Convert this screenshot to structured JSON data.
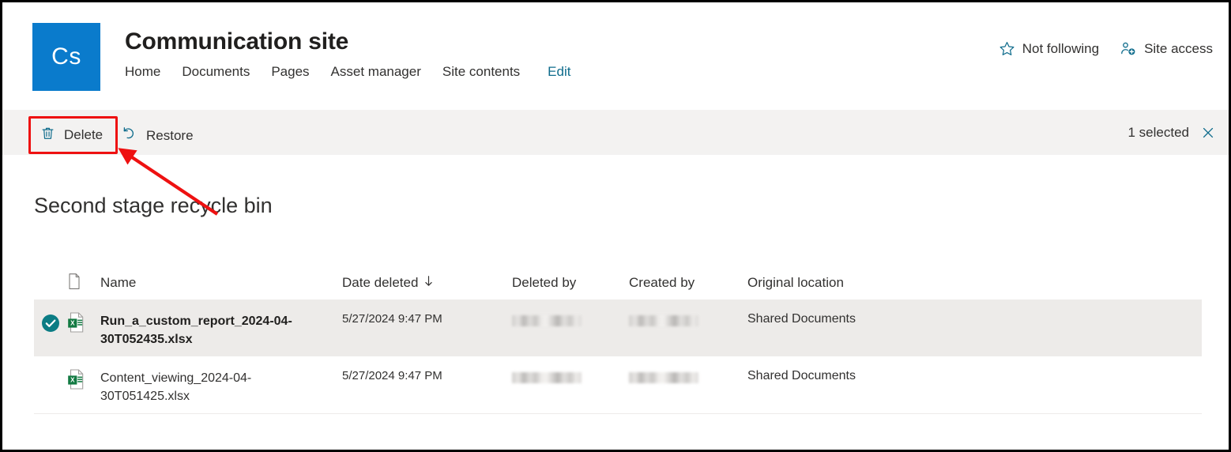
{
  "site": {
    "logo_text": "Cs",
    "logo_color": "#0A7BCC",
    "title": "Communication site",
    "nav": [
      {
        "label": "Home"
      },
      {
        "label": "Documents"
      },
      {
        "label": "Pages"
      },
      {
        "label": "Asset manager"
      },
      {
        "label": "Site contents"
      }
    ],
    "edit_link": "Edit",
    "edit_link_color": "#0f6c8c",
    "actions": [
      {
        "label": "Not following",
        "icon": "star-outline-icon"
      },
      {
        "label": "Site access",
        "icon": "people-add-icon"
      }
    ]
  },
  "command_bar": {
    "background": "#F3F2F1",
    "delete_label": "Delete",
    "delete_icon": "trash-icon",
    "delete_highlight_color": "#EE1111",
    "restore_label": "Restore",
    "restore_icon": "undo-arrow-icon",
    "selection_count": "1 selected",
    "close_icon": "close-icon"
  },
  "page": {
    "title": "Second stage recycle bin"
  },
  "table": {
    "columns": [
      {
        "key": "file_type",
        "label": "",
        "icon": "file-type-icon"
      },
      {
        "key": "name",
        "label": "Name"
      },
      {
        "key": "date_deleted",
        "label": "Date deleted",
        "sort": "descending",
        "sort_icon": "arrow-down-icon"
      },
      {
        "key": "deleted_by",
        "label": "Deleted by"
      },
      {
        "key": "created_by",
        "label": "Created by"
      },
      {
        "key": "original_location",
        "label": "Original location"
      }
    ],
    "selected_row_background": "#EDEBE9",
    "rows": [
      {
        "selected": true,
        "check_icon": "check-circle-icon",
        "check_color": "#0B7C84",
        "file_icon": "excel-icon",
        "name": "Run_a_custom_report_2024-04-30T052435.xlsx",
        "date_deleted": "5/27/2024 9:47 PM",
        "deleted_by": "",
        "deleted_by_redacted": true,
        "created_by": "",
        "created_by_redacted": true,
        "original_location": "Shared Documents"
      },
      {
        "selected": false,
        "check_icon": "",
        "file_icon": "excel-icon",
        "name": "Content_viewing_2024-04-30T051425.xlsx",
        "date_deleted": "5/27/2024 9:47 PM",
        "deleted_by": "",
        "deleted_by_redacted": true,
        "created_by": "",
        "created_by_redacted": true,
        "original_location": "Shared Documents"
      }
    ]
  },
  "annotation": {
    "type": "arrow",
    "color": "#EE1111",
    "points_to": "delete-button"
  }
}
